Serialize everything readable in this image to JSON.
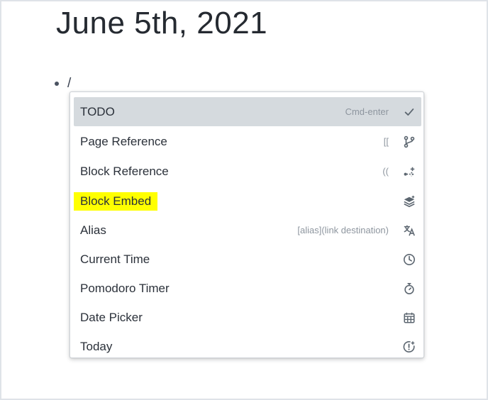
{
  "page": {
    "title": "June 5th, 2021"
  },
  "block": {
    "text": "/"
  },
  "menu": {
    "items": [
      {
        "label": "TODO",
        "shortcut": "Cmd-enter",
        "icon": "check-icon"
      },
      {
        "label": "Page Reference",
        "shortcut": "[[",
        "icon": "git-branch-icon"
      },
      {
        "label": "Block Reference",
        "shortcut": "((",
        "icon": "flow-branch-icon"
      },
      {
        "label": "Block Embed",
        "shortcut": "",
        "icon": "layers-icon"
      },
      {
        "label": "Alias",
        "shortcut": "[alias](link destination)",
        "icon": "translate-icon"
      },
      {
        "label": "Current Time",
        "shortcut": "",
        "icon": "clock-icon"
      },
      {
        "label": "Pomodoro Timer",
        "shortcut": "",
        "icon": "stopwatch-icon"
      },
      {
        "label": "Date Picker",
        "shortcut": "",
        "icon": "calendar-icon"
      },
      {
        "label": "Today",
        "shortcut": "",
        "icon": "time-alert-icon"
      }
    ]
  },
  "colors": {
    "highlight": "#ffff00",
    "active_item_bg": "#d5dade",
    "icon": "#5c6670"
  }
}
